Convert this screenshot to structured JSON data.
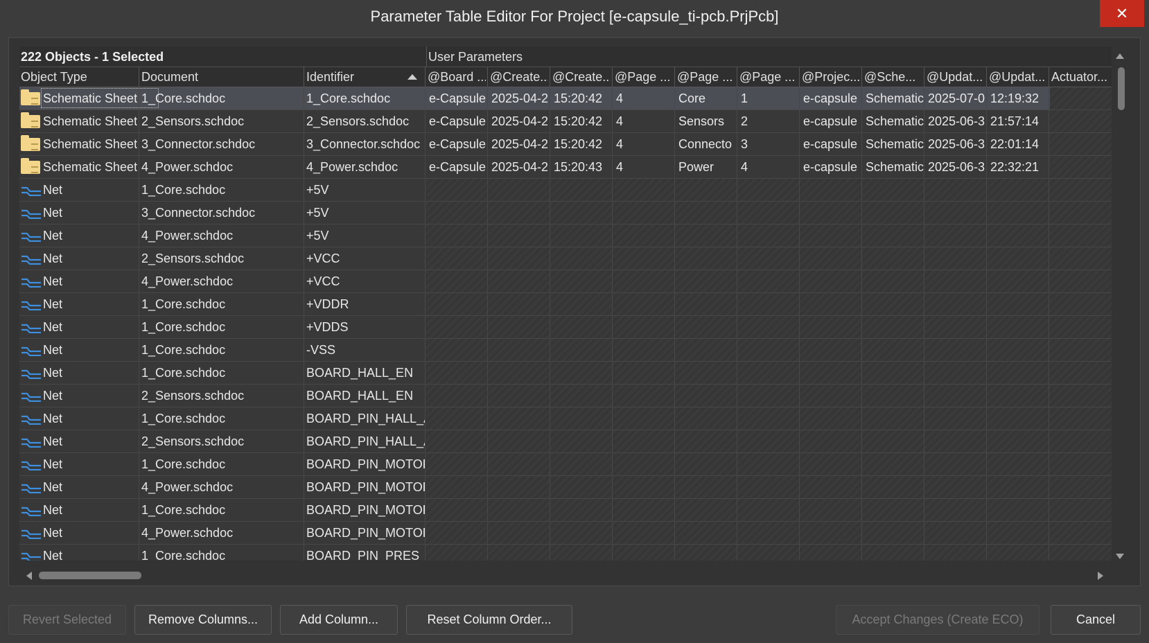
{
  "window": {
    "title": "Parameter Table Editor For Project [e-capsule_ti-pcb.PrjPcb]",
    "close_glyph": "✕"
  },
  "grid": {
    "group_left": "222 Objects - 1 Selected",
    "group_right": "User Parameters",
    "columns": [
      "Object Type",
      "Document",
      "Identifier",
      "@Board ...",
      "@Create...",
      "@Create...",
      "@Page ...",
      "@Page ...",
      "@Page ...",
      "@Projec...",
      "@Sche...",
      "@Updat...",
      "@Updat...",
      "Actuator..."
    ],
    "sort_column": "Identifier",
    "sort_direction": "ascending",
    "rows": [
      {
        "type": "Schematic Sheet",
        "icon": "folder-icon",
        "doc": "1_Core.schdoc",
        "id": "1_Core.schdoc",
        "p": [
          "e-Capsule",
          "2025-04-2",
          "15:20:42",
          "4",
          "Core",
          "1",
          "e-capsule",
          "Schematic",
          "2025-07-0",
          "12:19:32",
          ""
        ]
      },
      {
        "type": "Schematic Sheet",
        "icon": "folder-icon",
        "doc": "2_Sensors.schdoc",
        "id": "2_Sensors.schdoc",
        "p": [
          "e-Capsule",
          "2025-04-2",
          "15:20:42",
          "4",
          "Sensors",
          "2",
          "e-capsule",
          "Schematic",
          "2025-06-3",
          "21:57:14",
          ""
        ]
      },
      {
        "type": "Schematic Sheet",
        "icon": "folder-icon",
        "doc": "3_Connector.schdoc",
        "id": "3_Connector.schdoc",
        "p": [
          "e-Capsule",
          "2025-04-2",
          "15:20:42",
          "4",
          "Connecto",
          "3",
          "e-capsule",
          "Schematic",
          "2025-06-3",
          "22:01:14",
          ""
        ]
      },
      {
        "type": "Schematic Sheet",
        "icon": "folder-icon",
        "doc": "4_Power.schdoc",
        "id": "4_Power.schdoc",
        "p": [
          "e-Capsule",
          "2025-04-2",
          "15:20:43",
          "4",
          "Power",
          "4",
          "e-capsule",
          "Schematic",
          "2025-06-3",
          "22:32:21",
          ""
        ]
      },
      {
        "type": "Net",
        "icon": "net-icon",
        "doc": "1_Core.schdoc",
        "id": "+5V"
      },
      {
        "type": "Net",
        "icon": "net-icon",
        "doc": "3_Connector.schdoc",
        "id": "+5V"
      },
      {
        "type": "Net",
        "icon": "net-icon",
        "doc": "4_Power.schdoc",
        "id": "+5V"
      },
      {
        "type": "Net",
        "icon": "net-icon",
        "doc": "2_Sensors.schdoc",
        "id": "+VCC"
      },
      {
        "type": "Net",
        "icon": "net-icon",
        "doc": "4_Power.schdoc",
        "id": "+VCC"
      },
      {
        "type": "Net",
        "icon": "net-icon",
        "doc": "1_Core.schdoc",
        "id": "+VDDR"
      },
      {
        "type": "Net",
        "icon": "net-icon",
        "doc": "1_Core.schdoc",
        "id": "+VDDS"
      },
      {
        "type": "Net",
        "icon": "net-icon",
        "doc": "1_Core.schdoc",
        "id": "-VSS"
      },
      {
        "type": "Net",
        "icon": "net-icon",
        "doc": "1_Core.schdoc",
        "id": "BOARD_HALL_EN"
      },
      {
        "type": "Net",
        "icon": "net-icon",
        "doc": "2_Sensors.schdoc",
        "id": "BOARD_HALL_EN"
      },
      {
        "type": "Net",
        "icon": "net-icon",
        "doc": "1_Core.schdoc",
        "id": "BOARD_PIN_HALL_A"
      },
      {
        "type": "Net",
        "icon": "net-icon",
        "doc": "2_Sensors.schdoc",
        "id": "BOARD_PIN_HALL_A"
      },
      {
        "type": "Net",
        "icon": "net-icon",
        "doc": "1_Core.schdoc",
        "id": "BOARD_PIN_MOTOR"
      },
      {
        "type": "Net",
        "icon": "net-icon",
        "doc": "4_Power.schdoc",
        "id": "BOARD_PIN_MOTOR"
      },
      {
        "type": "Net",
        "icon": "net-icon",
        "doc": "1_Core.schdoc",
        "id": "BOARD_PIN_MOTOR"
      },
      {
        "type": "Net",
        "icon": "net-icon",
        "doc": "4_Power.schdoc",
        "id": "BOARD_PIN_MOTOR"
      },
      {
        "type": "Net",
        "icon": "net-icon",
        "doc": "1_Core.schdoc",
        "id": "BOARD_PIN_PRES_A"
      }
    ]
  },
  "buttons": {
    "revert": "Revert Selected",
    "remove_columns": "Remove Columns...",
    "add_column": "Add Column...",
    "reset_order": "Reset Column Order...",
    "accept": "Accept Changes (Create ECO)",
    "cancel": "Cancel"
  },
  "colors": {
    "background": "#3c3c3c",
    "close_button": "#c42b1c",
    "folder_icon": "#f4d68a",
    "net_icon": "#3d8fe0",
    "selected_row": "#4b4f55"
  }
}
